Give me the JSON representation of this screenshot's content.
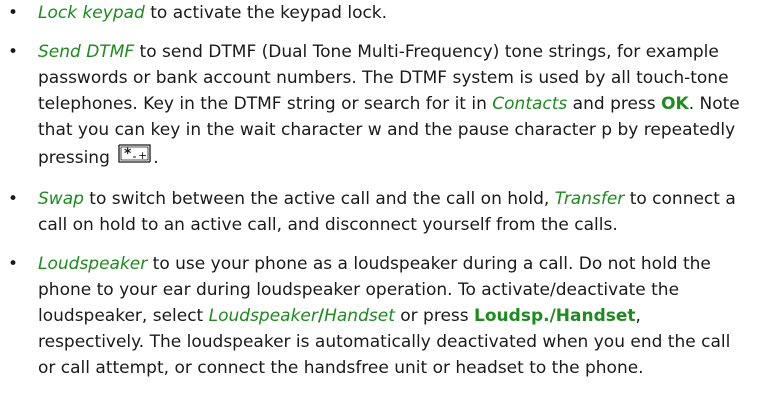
{
  "items": [
    {
      "term": "Lock keypad",
      "text": " to activate the keypad lock."
    },
    {
      "term": "Send DTMF",
      "text1": " to send DTMF (Dual Tone Multi-Frequency) tone strings, for example passwords or bank account numbers. The DTMF system is used by all touch-tone telephones. Key in the DTMF string or search for it in ",
      "term2": "Contacts",
      "text2": " and press ",
      "key1": "OK",
      "text3": ". Note that you can key in the wait character w and the pause character p by repeatedly pressing ",
      "keycap_icon": "star-plus-key-icon",
      "text4": "."
    },
    {
      "term": "Swap",
      "text1": " to switch between the active call and the call on hold, ",
      "term2": "Transfer",
      "text2": " to connect a call on hold to an active call, and disconnect yourself from the calls."
    },
    {
      "term": "Loudspeaker",
      "text1": " to use your phone as a loudspeaker during a call. Do not hold the phone to your ear during loudspeaker operation. To activate/deactivate the loudspeaker, select ",
      "term2": "Loudspeaker",
      "sep1": "/",
      "term3": "Handset",
      "text2": " or press ",
      "key1": "Loudsp.",
      "sep2": "/",
      "key2": "Handset",
      "text3": ", respectively. The loudspeaker is automatically deactivated when you end the call or call attempt, or connect the handsfree unit or headset to the phone."
    }
  ],
  "colors": {
    "accent": "#1f8a1f",
    "text": "#1a1a1a"
  }
}
